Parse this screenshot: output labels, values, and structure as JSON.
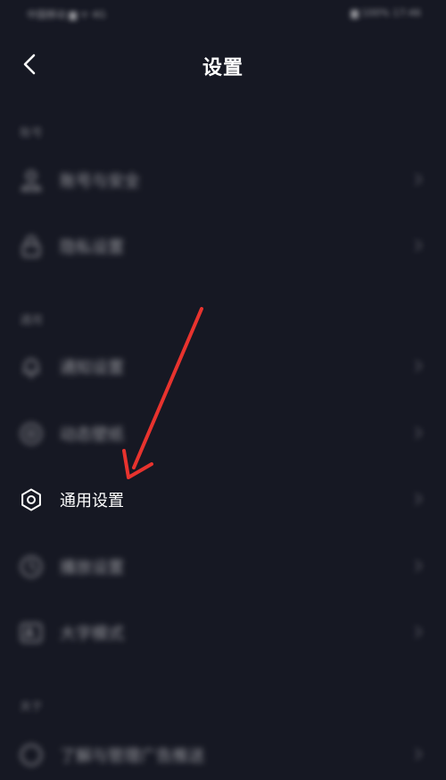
{
  "status_bar": {
    "carrier": "中国移动 ▆ ᯤ 4G",
    "right": "▆ 100% 17:46"
  },
  "header": {
    "title": "设置",
    "back_icon": "chevron-left-icon"
  },
  "sections": [
    {
      "label": "账号",
      "items": [
        {
          "label": "账号与安全",
          "icon": "user-icon"
        },
        {
          "label": "隐私设置",
          "icon": "lock-icon"
        }
      ]
    },
    {
      "label": "通用",
      "items": [
        {
          "label": "通知设置",
          "icon": "bell-icon"
        },
        {
          "label": "动态壁纸",
          "icon": "wallpaper-icon"
        },
        {
          "label": "通用设置",
          "icon": "gear-icon"
        },
        {
          "label": "播放设置",
          "icon": "clock-icon"
        },
        {
          "label": "大字模式",
          "icon": "font-size-icon"
        }
      ]
    },
    {
      "label": "关于",
      "items": [
        {
          "label": "了解与管理广告推送",
          "icon": "info-icon"
        }
      ]
    }
  ],
  "annotation": {
    "color": "#e8332e",
    "target": "通用设置"
  },
  "colors": {
    "background": "#161823",
    "text": "#ffffff",
    "muted": "#5c5e68"
  }
}
